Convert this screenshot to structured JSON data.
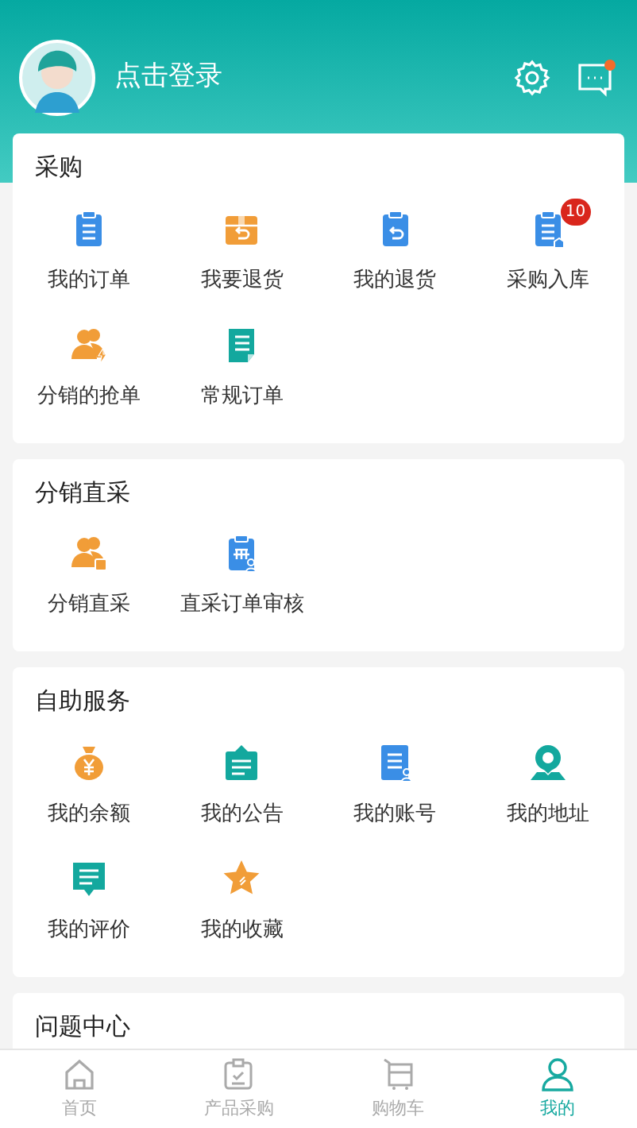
{
  "header": {
    "login_text": "点击登录",
    "messages_unread": true
  },
  "sections": [
    {
      "title": "采购",
      "items": [
        {
          "label": "我的订单"
        },
        {
          "label": "我要退货"
        },
        {
          "label": "我的退货"
        },
        {
          "label": "采购入库",
          "badge": "10"
        },
        {
          "label": "分销的抢单"
        },
        {
          "label": "常规订单"
        }
      ]
    },
    {
      "title": "分销直采",
      "items": [
        {
          "label": "分销直采"
        },
        {
          "label": "直采订单审核"
        }
      ]
    },
    {
      "title": "自助服务",
      "items": [
        {
          "label": "我的余额"
        },
        {
          "label": "我的公告"
        },
        {
          "label": "我的账号"
        },
        {
          "label": "我的地址"
        },
        {
          "label": "我的评价"
        },
        {
          "label": "我的收藏"
        }
      ]
    },
    {
      "title": "问题中心"
    }
  ],
  "tab_bar": [
    {
      "label": "首页",
      "selected": false
    },
    {
      "label": "产品采购",
      "selected": false
    },
    {
      "label": "购物车",
      "selected": false
    },
    {
      "label": "我的",
      "selected": true
    }
  ]
}
